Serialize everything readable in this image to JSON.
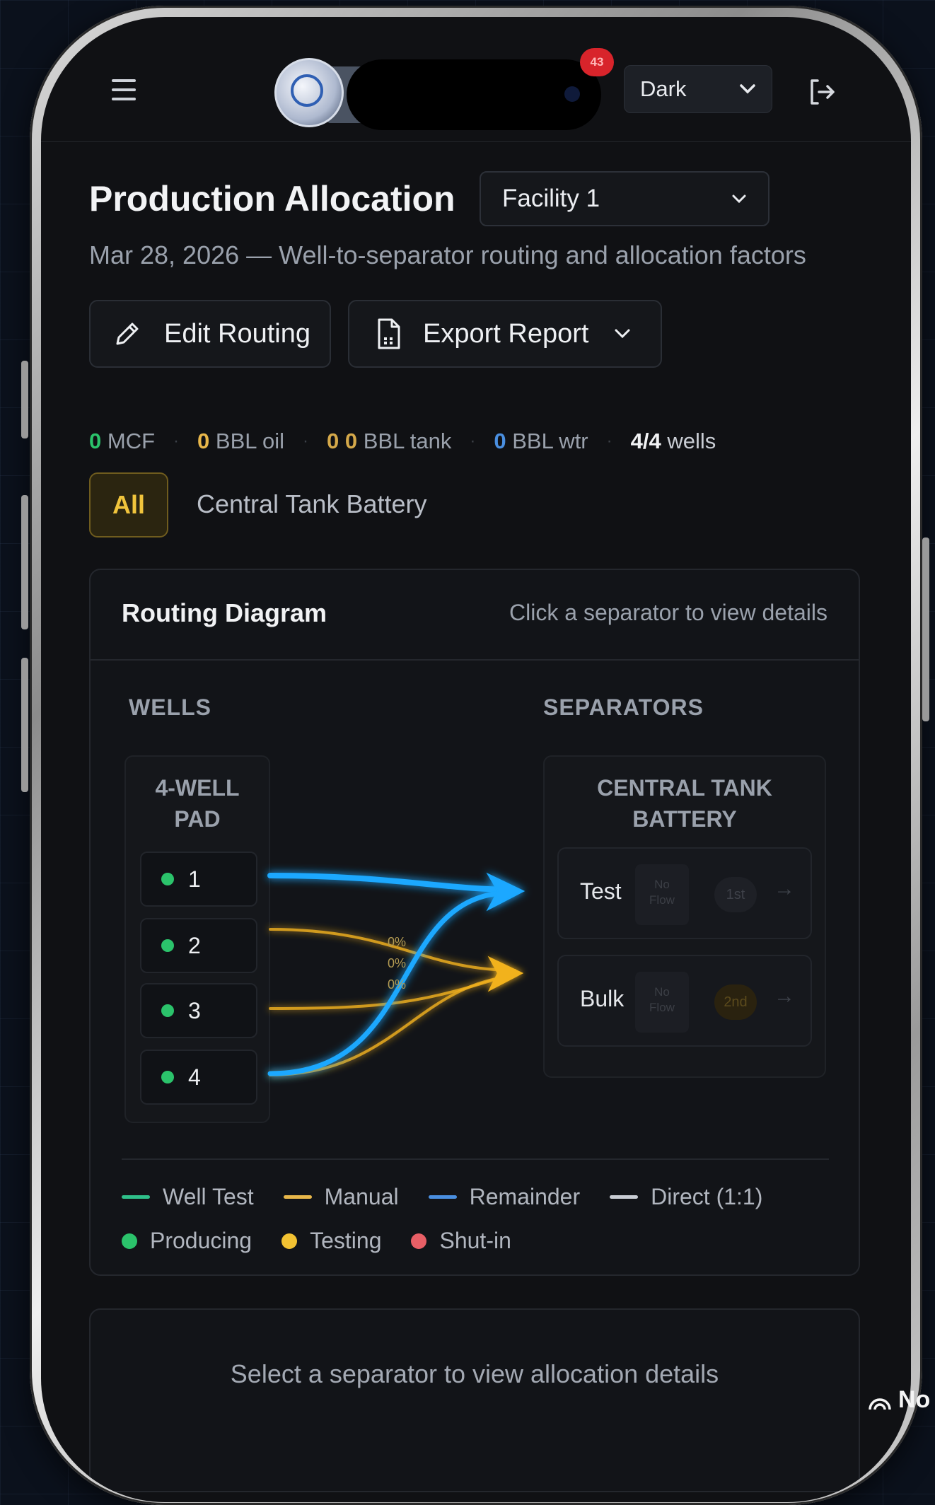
{
  "topbar": {
    "notification_count": "43",
    "theme": {
      "selected": "Dark"
    }
  },
  "header": {
    "title": "Production Allocation",
    "facility": "Facility 1",
    "subtitle": "Mar 28, 2026 — Well-to-separator routing and allocation factors"
  },
  "actions": {
    "edit_label": "Edit Routing",
    "export_label": "Export Report"
  },
  "stats": {
    "gas_value": "0",
    "gas_unit": "MCF",
    "gas_color": "#2bc36b",
    "oil_value": "0",
    "oil_unit": "BBL oil",
    "oil_color": "#e8b74a",
    "tank_value": "0 0",
    "tank_unit": "BBL tank",
    "tank_color": "#d5a94a",
    "water_value": "0",
    "water_unit": "BBL wtr",
    "water_color": "#4a8fe0",
    "wells_value": "4/4",
    "wells_unit": "wells"
  },
  "filters": {
    "all_label": "All",
    "battery_label": "Central Tank Battery"
  },
  "diagram": {
    "title": "Routing Diagram",
    "hint": "Click a separator to view details",
    "wells_heading": "WELLS",
    "separators_heading": "SEPARATORS",
    "pad_line1": "4-WELL",
    "pad_line2": "PAD",
    "battery_line1": "CENTRAL TANK",
    "battery_line2": "BATTERY",
    "wells": [
      {
        "label": "1",
        "status": "Producing"
      },
      {
        "label": "2",
        "status": "Producing"
      },
      {
        "label": "3",
        "status": "Producing"
      },
      {
        "label": "4",
        "status": "Producing"
      }
    ],
    "separators": [
      {
        "name": "Test",
        "flow_line1": "No",
        "flow_line2": "Flow",
        "order": "1st"
      },
      {
        "name": "Bulk",
        "flow_line1": "No",
        "flow_line2": "Flow",
        "order": "2nd"
      }
    ],
    "route_labels": [
      "0%",
      "0%",
      "0%"
    ],
    "colors": {
      "blue": "#1aa8ff",
      "amber": "#f2b21e"
    }
  },
  "legend": {
    "well_test": "Well Test",
    "well_test_color": "#2fc08a",
    "manual": "Manual",
    "manual_color": "#e8b74a",
    "remainder": "Remainder",
    "remainder_color": "#4a8fe0",
    "direct": "Direct (1:1)",
    "direct_color": "#c9cdd4",
    "producing": "Producing",
    "producing_color": "#2bc36b",
    "testing": "Testing",
    "testing_color": "#f2c232",
    "shut_in": "Shut-in",
    "shut_in_color": "#e85f66"
  },
  "details": {
    "empty_text": "Select a separator to view allocation details"
  },
  "overlay": {
    "corner_text": "No"
  }
}
